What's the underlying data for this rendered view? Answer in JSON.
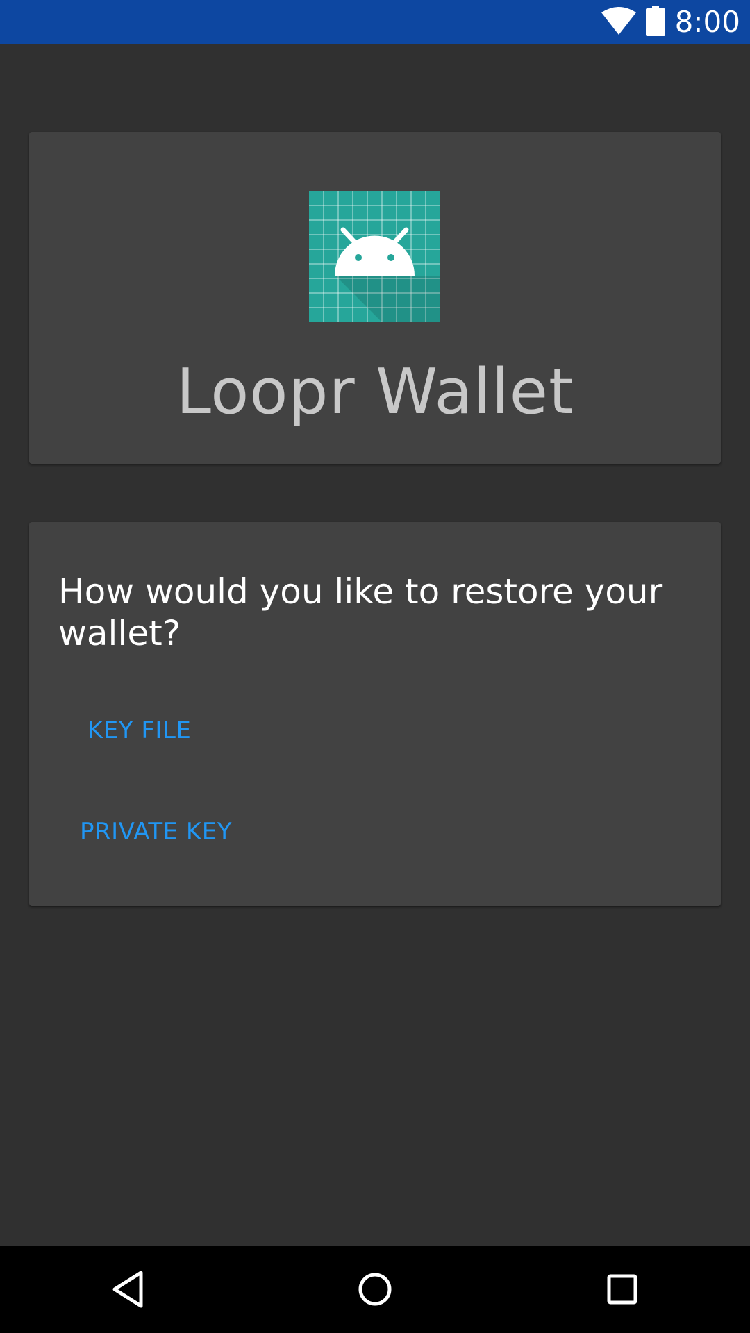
{
  "status_bar": {
    "time": "8:00",
    "icons": [
      "wifi-icon",
      "battery-icon"
    ],
    "color": "#0d47a1"
  },
  "header_card": {
    "logo_icon": "android-icon",
    "title": "Loopr Wallet"
  },
  "restore_card": {
    "question": "How would you like to restore your wallet?",
    "options": [
      {
        "label": "KEY FILE"
      },
      {
        "label": "PRIVATE KEY"
      }
    ],
    "accent_color": "#2196f3"
  },
  "nav_bar": {
    "buttons": [
      "back-icon",
      "home-icon",
      "recents-icon"
    ]
  },
  "colors": {
    "background": "#303030",
    "card": "#424242",
    "logo": "#26a69a"
  }
}
